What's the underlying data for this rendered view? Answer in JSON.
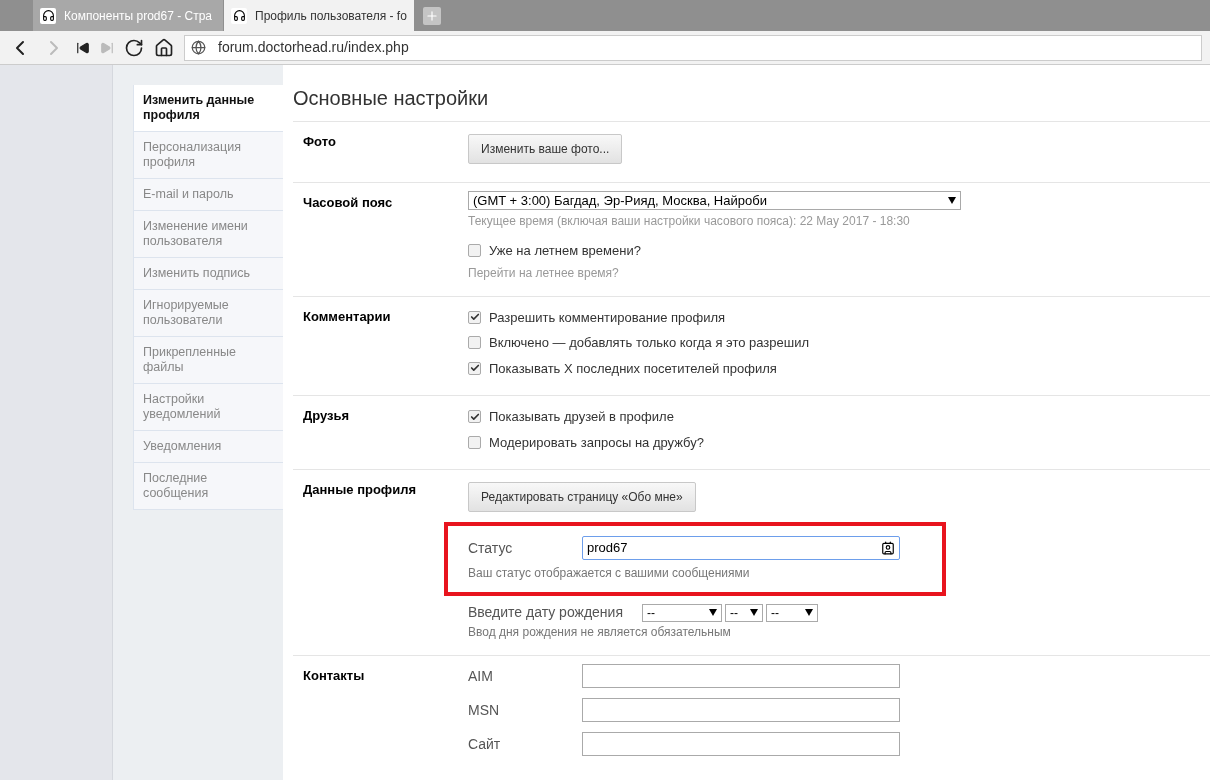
{
  "browser": {
    "tabs": [
      {
        "title": "Компоненты prod67 - Стра",
        "selected": false
      },
      {
        "title": "Профиль пользователя - fo",
        "selected": true
      }
    ],
    "url": "forum.doctorhead.ru/index.php"
  },
  "sidebar": {
    "items": [
      {
        "label": "Изменить данные профиля",
        "selected": true
      },
      {
        "label": "Персонализация профиля",
        "selected": false
      },
      {
        "label": "E-mail и пароль",
        "selected": false
      },
      {
        "label": "Изменение имени пользователя",
        "selected": false
      },
      {
        "label": "Изменить подпись",
        "selected": false
      },
      {
        "label": "Игнорируемые пользователи",
        "selected": false
      },
      {
        "label": "Прикрепленные файлы",
        "selected": false
      },
      {
        "label": "Настройки уведомлений",
        "selected": false
      },
      {
        "label": "Уведомления",
        "selected": false
      },
      {
        "label": "Последние сообщения",
        "selected": false
      }
    ]
  },
  "page_title": "Основные настройки",
  "sections": [
    {
      "label": "Фото",
      "items": [
        {
          "kind": "button",
          "label": "Изменить ваше фото..."
        }
      ]
    },
    {
      "label": "Часовой пояс",
      "items": [
        {
          "kind": "select",
          "value": "(GMT + 3:00) Багдад, Эр-Рияд, Москва, Найроби",
          "hint": "Текущее время (включая ваши настройки часового пояса): 22 May 2017 - 18:30"
        },
        {
          "kind": "checkbox",
          "label": "Уже на летнем времени?",
          "checked": false,
          "hint": "Перейти на летнее время?"
        }
      ]
    },
    {
      "label": "Комментарии",
      "items": [
        {
          "kind": "checkbox",
          "label": "Разрешить комментирование профиля",
          "checked": true
        },
        {
          "kind": "checkbox",
          "label": "Включено — добавлять только когда я это разрешил",
          "checked": false
        },
        {
          "kind": "checkbox",
          "label": "Показывать X последних посетителей профиля",
          "checked": true
        }
      ]
    },
    {
      "label": "Друзья",
      "items": [
        {
          "kind": "checkbox",
          "label": "Показывать друзей в профиле",
          "checked": true
        },
        {
          "kind": "checkbox",
          "label": "Модерировать запросы на дружбу?",
          "checked": false
        }
      ]
    },
    {
      "label": "Данные профиля",
      "items": [
        {
          "kind": "button",
          "label": "Редактировать страницу «Обо мне»"
        },
        {
          "kind": "field",
          "label": "Статус",
          "value": "prod67",
          "hint": "Ваш статус отображается с вашими сообщениями",
          "highlighted": true
        },
        {
          "kind": "date",
          "label": "Введите дату рождения",
          "selects": [
            "--",
            "--",
            "--"
          ],
          "hint": "Ввод дня рождения не является обязательным"
        }
      ]
    },
    {
      "label": "Контакты",
      "items": [
        {
          "kind": "field",
          "label": "AIM",
          "value": "",
          "highlighted": false
        },
        {
          "kind": "field",
          "label": "MSN",
          "value": "",
          "highlighted": false
        },
        {
          "kind": "field",
          "label": "Сайт",
          "value": "",
          "highlighted": false
        }
      ]
    }
  ]
}
